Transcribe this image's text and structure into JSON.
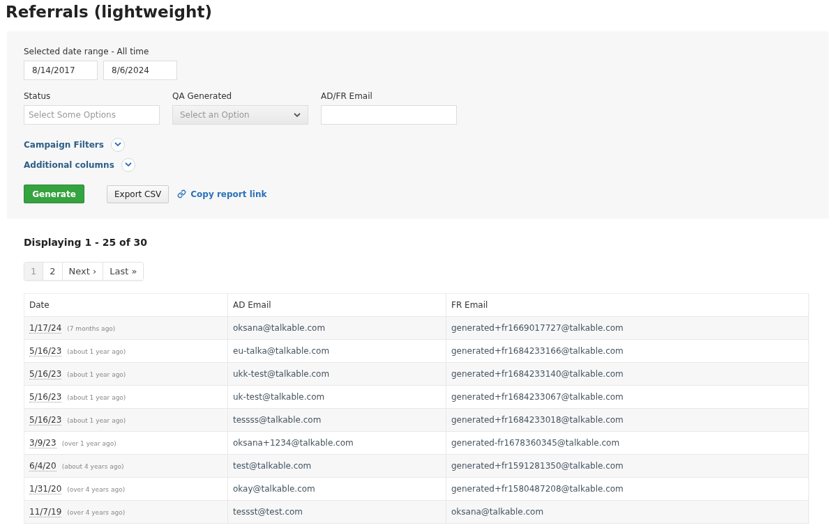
{
  "title": "Referrals (lightweight)",
  "filters": {
    "date_range_label": "Selected date range - All time",
    "date_from": "8/14/2017",
    "date_to": "8/6/2024",
    "status": {
      "label": "Status",
      "placeholder": "Select Some Options"
    },
    "qa_generated": {
      "label": "QA Generated",
      "placeholder": "Select an Option"
    },
    "email": {
      "label": "AD/FR Email"
    },
    "toggles": [
      {
        "label": "Campaign Filters",
        "expanded": false
      },
      {
        "label": "Additional columns",
        "expanded": false
      }
    ],
    "generate_button": "Generate",
    "export_button": "Export CSV",
    "copy_link": "Copy report link"
  },
  "summary": "Displaying 1 - 25 of 30",
  "pagination": [
    {
      "label": "1",
      "selected": true
    },
    {
      "label": "2",
      "selected": false
    },
    {
      "label": "Next ›",
      "selected": false
    },
    {
      "label": "Last »",
      "selected": false
    }
  ],
  "table": {
    "columns": [
      "Date",
      "AD Email",
      "FR Email"
    ],
    "rows": [
      {
        "date": "1/17/24",
        "ago": "(7 months ago)",
        "ad": "oksana@talkable.com",
        "fr": "generated+fr1669017727@talkable.com"
      },
      {
        "date": "5/16/23",
        "ago": "(about 1 year ago)",
        "ad": "eu-talka@talkable.com",
        "fr": "generated+fr1684233166@talkable.com"
      },
      {
        "date": "5/16/23",
        "ago": "(about 1 year ago)",
        "ad": "ukk-test@talkable.com",
        "fr": "generated+fr1684233140@talkable.com"
      },
      {
        "date": "5/16/23",
        "ago": "(about 1 year ago)",
        "ad": "uk-test@talkable.com",
        "fr": "generated+fr1684233067@talkable.com"
      },
      {
        "date": "5/16/23",
        "ago": "(about 1 year ago)",
        "ad": "tessss@talkable.com",
        "fr": "generated+fr1684233018@talkable.com"
      },
      {
        "date": "3/9/23",
        "ago": "(over 1 year ago)",
        "ad": "oksana+1234@talkable.com",
        "fr": "generated-fr1678360345@talkable.com"
      },
      {
        "date": "6/4/20",
        "ago": "(about 4 years ago)",
        "ad": "test@talkable.com",
        "fr": "generated+fr1591281350@talkable.com"
      },
      {
        "date": "1/31/20",
        "ago": "(over 4 years ago)",
        "ad": "okay@talkable.com",
        "fr": "generated+fr1580487208@talkable.com"
      },
      {
        "date": "11/7/19",
        "ago": "(over 4 years ago)",
        "ad": "tessst@test.com",
        "fr": "oksana@talkable.com"
      }
    ]
  }
}
